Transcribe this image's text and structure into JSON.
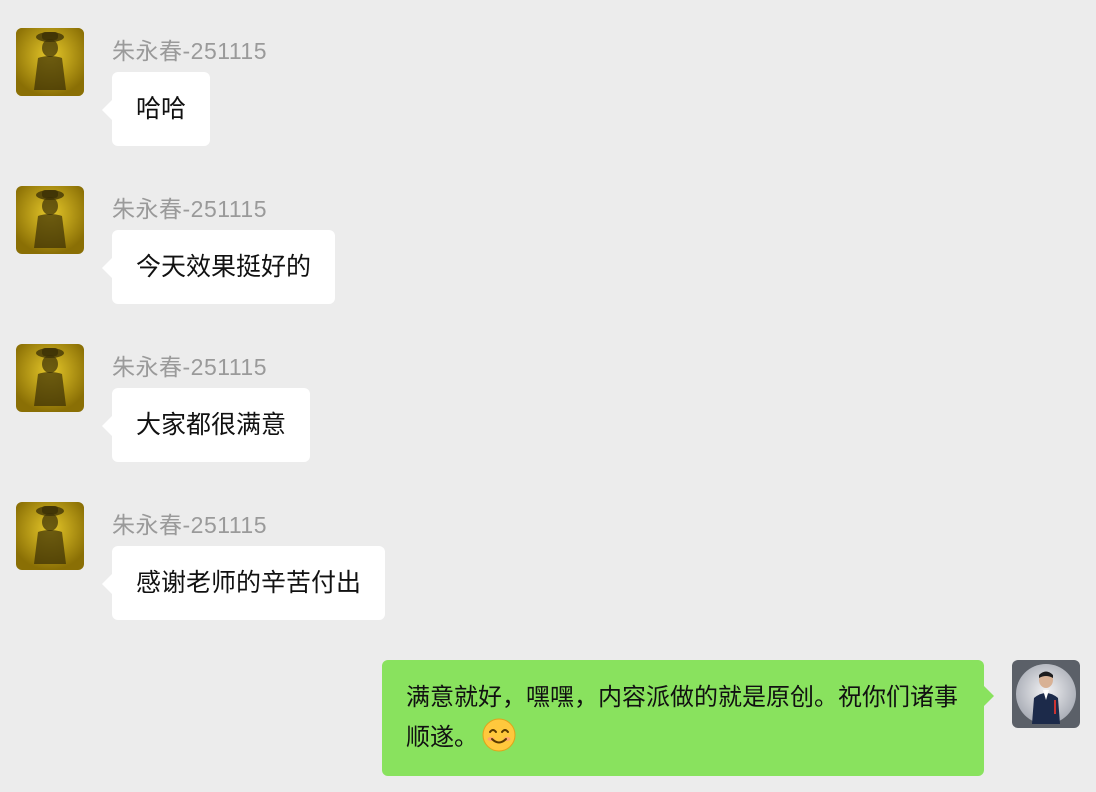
{
  "chat": {
    "messages": [
      {
        "sender": "朱永春-251115",
        "text": "哈哈"
      },
      {
        "sender": "朱永春-251115",
        "text": "今天效果挺好的"
      },
      {
        "sender": "朱永春-251115",
        "text": "大家都很满意"
      },
      {
        "sender": "朱永春-251115",
        "text": "感谢老师的辛苦付出"
      }
    ],
    "reply": {
      "text": "满意就好，嘿嘿，内容派做的就是原创。祝你们诸事顺遂。",
      "emoji": "smiling-face-emoji"
    }
  },
  "colors": {
    "background": "#ececec",
    "incoming_bubble": "#ffffff",
    "outgoing_bubble": "#89e25e",
    "sender_name": "#9a9a9a"
  }
}
